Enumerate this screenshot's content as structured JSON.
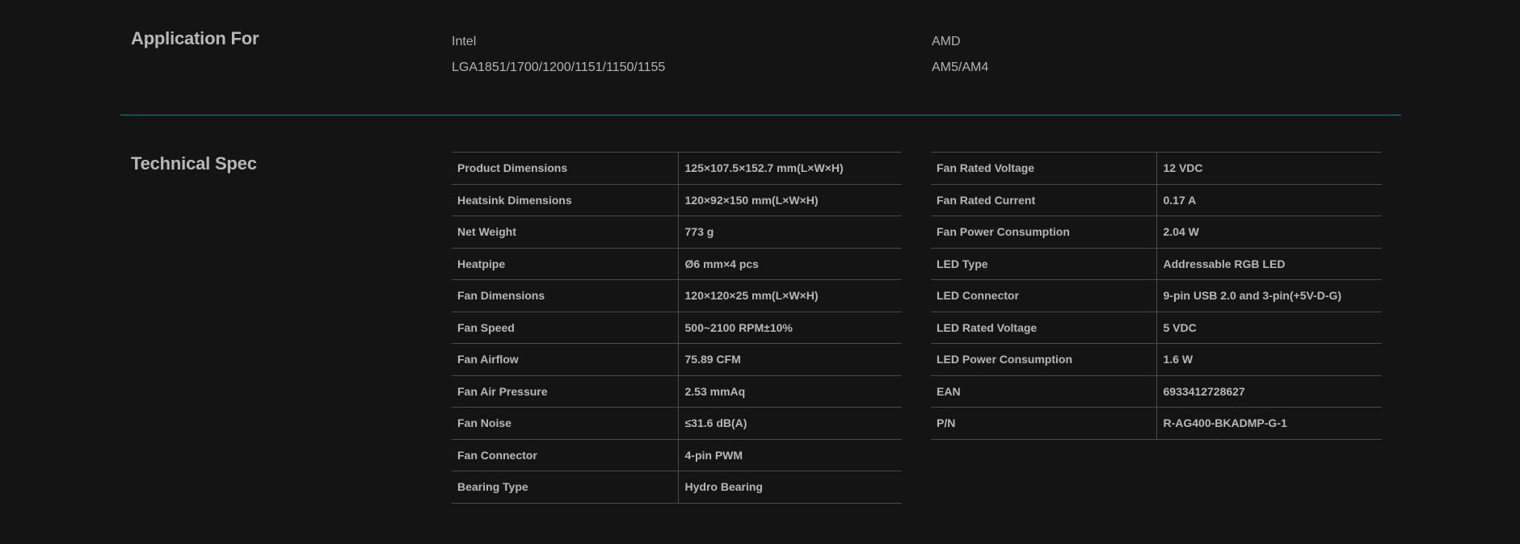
{
  "application": {
    "title": "Application For",
    "intel": {
      "brand": "Intel",
      "sockets": "LGA1851/1700/1200/1151/1150/1155"
    },
    "amd": {
      "brand": "AMD",
      "sockets": "AM5/AM4"
    }
  },
  "technical": {
    "title": "Technical Spec",
    "left": [
      {
        "k": "Product Dimensions",
        "v": "125×107.5×152.7 mm(L×W×H)"
      },
      {
        "k": "Heatsink Dimensions",
        "v": "120×92×150 mm(L×W×H)"
      },
      {
        "k": "Net Weight",
        "v": "773 g"
      },
      {
        "k": "Heatpipe",
        "v": "Ø6 mm×4 pcs"
      },
      {
        "k": "Fan Dimensions",
        "v": "120×120×25 mm(L×W×H)"
      },
      {
        "k": "Fan Speed",
        "v": "500~2100 RPM±10%"
      },
      {
        "k": "Fan Airflow",
        "v": "75.89 CFM"
      },
      {
        "k": "Fan Air Pressure",
        "v": "2.53 mmAq"
      },
      {
        "k": "Fan Noise",
        "v": "≤31.6 dB(A)"
      },
      {
        "k": "Fan Connector",
        "v": "4-pin PWM"
      },
      {
        "k": "Bearing Type",
        "v": "Hydro Bearing"
      }
    ],
    "right": [
      {
        "k": "Fan Rated Voltage",
        "v": "12 VDC"
      },
      {
        "k": "Fan Rated Current",
        "v": "0.17 A"
      },
      {
        "k": "Fan Power Consumption",
        "v": "2.04 W"
      },
      {
        "k": "LED Type",
        "v": "Addressable RGB LED"
      },
      {
        "k": "LED Connector",
        "v": "9-pin USB 2.0 and 3-pin(+5V-D-G)"
      },
      {
        "k": "LED Rated Voltage",
        "v": "5 VDC"
      },
      {
        "k": "LED Power Consumption",
        "v": "1.6 W"
      },
      {
        "k": "EAN",
        "v": "6933412728627"
      },
      {
        "k": "P/N",
        "v": "R-AG400-BKADMP-G-1"
      }
    ]
  },
  "colors": {
    "background": "#141414",
    "divider": "#2a7377",
    "table_border": "#4a4a4a",
    "text": "#b8b8b8"
  }
}
